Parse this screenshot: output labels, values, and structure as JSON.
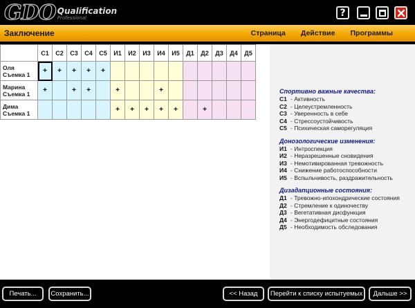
{
  "app": {
    "logo_mark": "GDO",
    "logo_title": "Qualification",
    "logo_sub": "Professional"
  },
  "window_buttons": {
    "help": "?"
  },
  "header": {
    "title": "Заключение",
    "menu": [
      "Страница",
      "Действие",
      "Программы"
    ]
  },
  "table": {
    "columns": [
      "С1",
      "С2",
      "С3",
      "С4",
      "С5",
      "И1",
      "И2",
      "И3",
      "И4",
      "И5",
      "Д1",
      "Д2",
      "Д3",
      "Д4",
      "Д5"
    ],
    "groups": [
      "c",
      "c",
      "c",
      "c",
      "c",
      "i",
      "i",
      "i",
      "i",
      "i",
      "d",
      "d",
      "d",
      "d",
      "d"
    ],
    "rows": [
      {
        "name": "Оля",
        "session": "Съемка 1",
        "cells": [
          "+",
          "+",
          "+",
          "+",
          "+",
          "",
          "",
          "",
          "",
          "",
          "",
          "",
          "",
          "",
          ""
        ]
      },
      {
        "name": "Марина",
        "session": "Съемка 1",
        "cells": [
          "+",
          "",
          "+",
          "+",
          "",
          "+",
          "",
          "",
          "+",
          "",
          "",
          "",
          "",
          "",
          ""
        ]
      },
      {
        "name": "Дима",
        "session": "Съемка 1",
        "cells": [
          "",
          "",
          "",
          "",
          "",
          "+",
          "+",
          "+",
          "+",
          "+",
          "",
          "+",
          "",
          "",
          ""
        ]
      }
    ]
  },
  "legend": [
    {
      "title": "Спортивно важные качества:",
      "items": [
        {
          "code": "С1",
          "text": "- Активность"
        },
        {
          "code": "С2",
          "text": "- Целеустремленность"
        },
        {
          "code": "С3",
          "text": "- Уверенность в себе"
        },
        {
          "code": "С4",
          "text": "- Стрессоустойчивость"
        },
        {
          "code": "С5",
          "text": "- Психическая саморегуляция"
        }
      ]
    },
    {
      "title": "Донозологические изменения:",
      "items": [
        {
          "code": "И1",
          "text": "- Интроспекция"
        },
        {
          "code": "И2",
          "text": "- Неразрешенные сновидения"
        },
        {
          "code": "И3",
          "text": "- Немотивированная тревожность"
        },
        {
          "code": "И4",
          "text": "- Снижение работоспособности"
        },
        {
          "code": "И5",
          "text": "- Вспыльчивость, раздражительность"
        }
      ]
    },
    {
      "title": "Дизадапционные состояния:",
      "items": [
        {
          "code": "Д1",
          "text": "- Тревожно-ипохондрические состояния"
        },
        {
          "code": "Д2",
          "text": "- Стремление к одиночеству"
        },
        {
          "code": "Д3",
          "text": "- Вегетативная дисфункция"
        },
        {
          "code": "Д4",
          "text": "- Энергодефицитные состояния"
        },
        {
          "code": "Д5",
          "text": "- Необходимость обследования"
        }
      ]
    }
  ],
  "bottom": {
    "print": "Печать...",
    "save": "Сохранить...",
    "back": "<< Назад",
    "list": "Перейти к списку испытуемых",
    "next": "Дальше >>"
  },
  "colors": {
    "header_orange": "#f4a700",
    "c_group": "#d7f5ff",
    "i_group": "#fffed6",
    "d_group": "#f6e0f2",
    "legend_title": "#111a8a",
    "close_red": "#d8200f"
  }
}
